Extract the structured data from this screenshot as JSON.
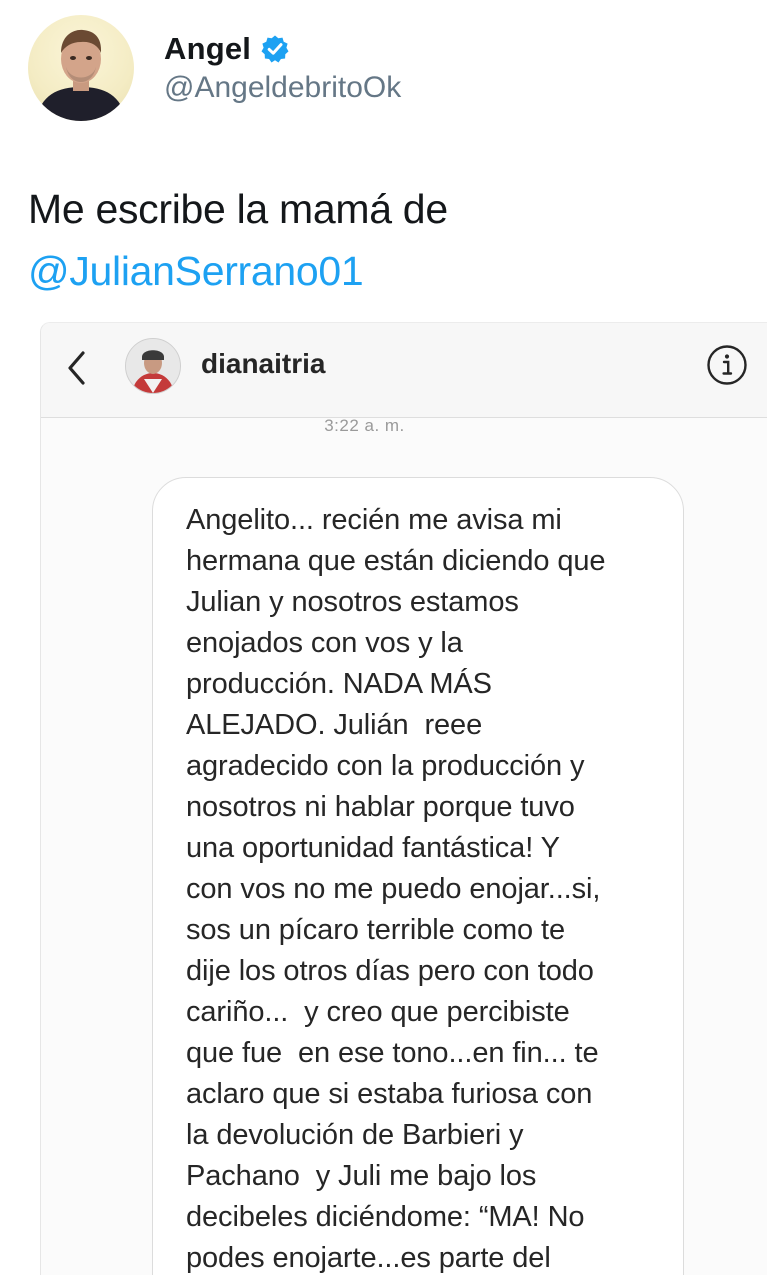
{
  "tweet": {
    "author_name": "Angel",
    "author_handle": "@AngeldebritoOk",
    "text_line1": "Me escribe la mamá de",
    "mention": "@JulianSerrano01"
  },
  "dm": {
    "username": "dianaitria",
    "timestamp": "3:22 a. m.",
    "message_lines": [
      "Angelito... recién me avisa mi",
      "hermana que están diciendo que",
      "Julian y nosotros estamos",
      "enojados con vos y la",
      "producción. NADA MÁS",
      "ALEJADO. Julián  reee",
      "agradecido con la producción y",
      "nosotros ni hablar porque tuvo",
      "una oportunidad fantástica! Y",
      "con vos no me puedo enojar...si,",
      "sos un pícaro terrible como te",
      "dije los otros días pero con todo",
      "cariño...  y creo que percibiste",
      "que fue  en ese tono...en fin... te",
      "aclaro que si estaba furiosa con",
      "la devolución de Barbieri y",
      "Pachano  y Juli me bajo los",
      "decibeles diciéndome: “MA! No",
      "podes enojarte...es parte del"
    ]
  },
  "icons": {
    "verified": "verified-badge-icon",
    "back": "chevron-left-icon",
    "info": "info-icon"
  },
  "colors": {
    "mention": "#1da1f2",
    "verified": "#1da1f2",
    "handle": "#657786",
    "text": "#14171a"
  }
}
